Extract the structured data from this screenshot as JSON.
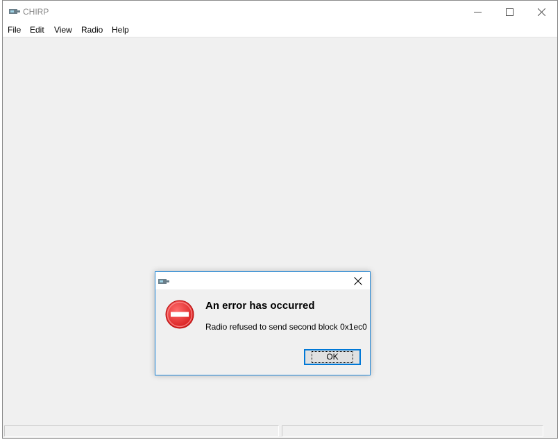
{
  "window": {
    "title": "CHIRP",
    "minimize_glyph": "—",
    "maximize_glyph": "☐",
    "close_glyph": "✕"
  },
  "menu": {
    "items": [
      "File",
      "Edit",
      "View",
      "Radio",
      "Help"
    ]
  },
  "dialog": {
    "heading": "An error has occurred",
    "message": "Radio refused to send second block 0x1ec0",
    "ok_label": "OK",
    "icon": "error-icon"
  },
  "colors": {
    "accent": "#1883d7",
    "error": "#e81123"
  }
}
